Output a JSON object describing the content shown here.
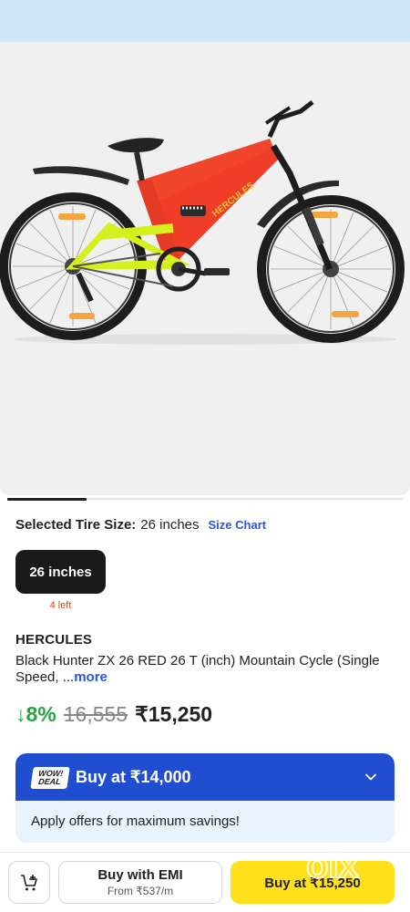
{
  "product": {
    "image_alt": "HERCULES mountain cycle",
    "frame_text": "HERCULES",
    "selected_size_label": "Selected Tire Size:",
    "selected_size_value": "26 inches",
    "size_chart_label": "Size Chart",
    "size_option": "26 inches",
    "stock_text": "4 left",
    "brand": "HERCULES",
    "title": "Black Hunter ZX 26 RED 26 T (inch) Mountain Cycle (Single Speed, ...",
    "title_more": "more",
    "discount": "↓8%",
    "mrp": "16,555",
    "price": "₹15,250",
    "image_count_active": 1
  },
  "deal": {
    "badge_line1": "WOW!",
    "badge_line2": "DEAL",
    "headline": "Buy at ₹14,000",
    "subtext": "Apply offers for maximum savings!",
    "chevron_icon": "chevron-down-icon"
  },
  "bottom_bar": {
    "cart_icon": "add-to-cart-icon",
    "emi_label": "Buy with EMI",
    "emi_sub": "From ₹537/m",
    "buy_label": "Buy at ₹15,250"
  },
  "watermark": "olx",
  "colors": {
    "top_strip": "#cfe6fb",
    "accent_blue": "#2a55e5",
    "deal_blue": "#1f4fd0",
    "buy_yellow": "#ffe11b",
    "discount_green": "#26a541",
    "stock_orange": "#d84315",
    "frame_red": "#f0452a",
    "frame_neon": "#d6ef1e"
  }
}
